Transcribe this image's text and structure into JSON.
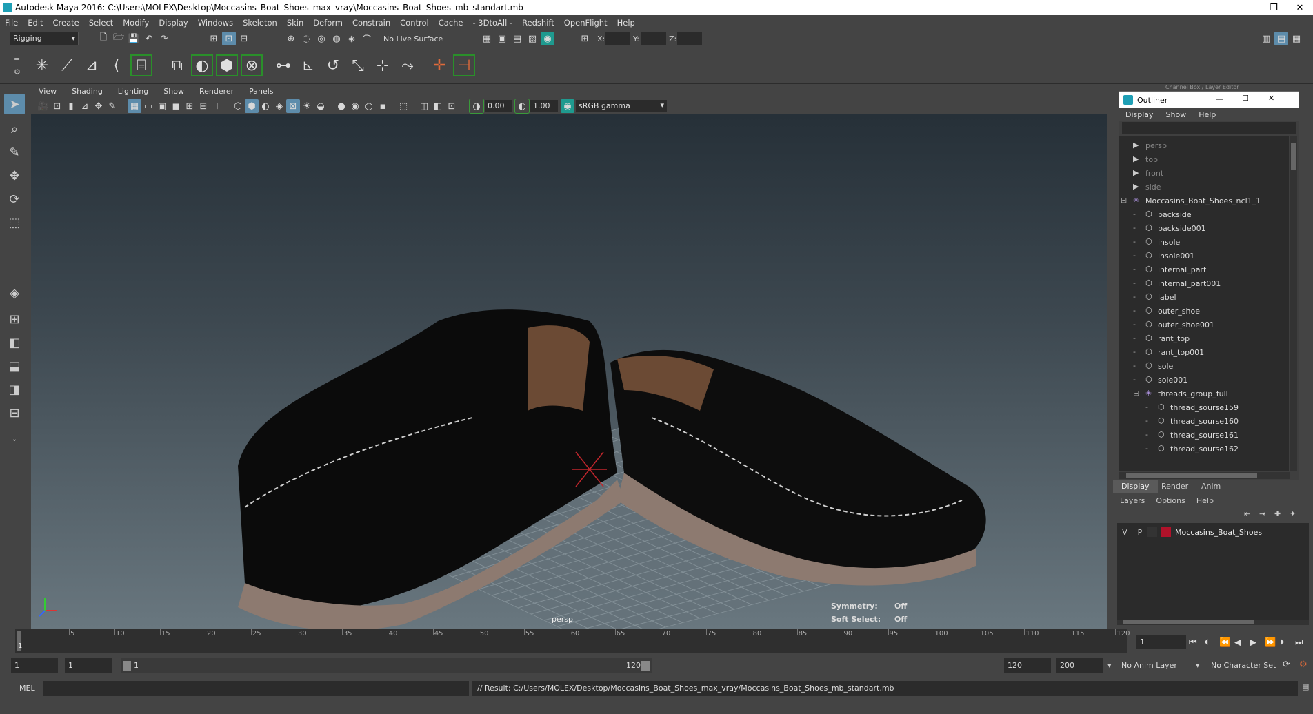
{
  "window": {
    "title": "Autodesk Maya 2016: C:\\Users\\MOLEX\\Desktop\\Moccasins_Boat_Shoes_max_vray\\Moccasins_Boat_Shoes_mb_standart.mb",
    "minimize": "—",
    "restore": "❐",
    "close": "✕"
  },
  "menus": [
    "File",
    "Edit",
    "Create",
    "Select",
    "Modify",
    "Display",
    "Windows",
    "Skeleton",
    "Skin",
    "Deform",
    "Constrain",
    "Control",
    "Cache",
    "- 3DtoAll -",
    "Redshift",
    "OpenFlight",
    "Help"
  ],
  "status_line": {
    "mode": "Rigging",
    "live_surface": "No Live Surface",
    "x_label": "X:",
    "y_label": "Y:",
    "z_label": "Z:"
  },
  "viewport": {
    "menus": [
      "View",
      "Shading",
      "Lighting",
      "Show",
      "Renderer",
      "Panels"
    ],
    "exposure": "0.00",
    "gamma": "1.00",
    "color_space": "sRGB gamma",
    "camera_label": "persp",
    "hud": {
      "symmetry_label": "Symmetry:",
      "symmetry_value": "Off",
      "soft_select_label": "Soft Select:",
      "soft_select_value": "Off"
    }
  },
  "channel_box_header": "Channel Box / Layer Editor",
  "outliner": {
    "title": "Outliner",
    "menus": [
      "Display",
      "Show",
      "Help"
    ],
    "items": [
      {
        "label": "persp",
        "kind": "camera",
        "depth": 0,
        "dim": true
      },
      {
        "label": "top",
        "kind": "camera",
        "depth": 0,
        "dim": true
      },
      {
        "label": "front",
        "kind": "camera",
        "depth": 0,
        "dim": true
      },
      {
        "label": "side",
        "kind": "camera",
        "depth": 0,
        "dim": true
      },
      {
        "label": "Moccasins_Boat_Shoes_ncl1_1",
        "kind": "group",
        "depth": 0,
        "expanded": true
      },
      {
        "label": "backside",
        "kind": "mesh",
        "depth": 1
      },
      {
        "label": "backside001",
        "kind": "mesh",
        "depth": 1
      },
      {
        "label": "insole",
        "kind": "mesh",
        "depth": 1
      },
      {
        "label": "insole001",
        "kind": "mesh",
        "depth": 1
      },
      {
        "label": "internal_part",
        "kind": "mesh",
        "depth": 1
      },
      {
        "label": "internal_part001",
        "kind": "mesh",
        "depth": 1
      },
      {
        "label": "label",
        "kind": "mesh",
        "depth": 1
      },
      {
        "label": "outer_shoe",
        "kind": "mesh",
        "depth": 1
      },
      {
        "label": "outer_shoe001",
        "kind": "mesh",
        "depth": 1
      },
      {
        "label": "rant_top",
        "kind": "mesh",
        "depth": 1
      },
      {
        "label": "rant_top001",
        "kind": "mesh",
        "depth": 1
      },
      {
        "label": "sole",
        "kind": "mesh",
        "depth": 1
      },
      {
        "label": "sole001",
        "kind": "mesh",
        "depth": 1
      },
      {
        "label": "threads_group_full",
        "kind": "group",
        "depth": 1,
        "expanded": true
      },
      {
        "label": "thread_sourse159",
        "kind": "mesh",
        "depth": 2
      },
      {
        "label": "thread_sourse160",
        "kind": "mesh",
        "depth": 2
      },
      {
        "label": "thread_sourse161",
        "kind": "mesh",
        "depth": 2
      },
      {
        "label": "thread_sourse162",
        "kind": "mesh",
        "depth": 2
      }
    ]
  },
  "layer_editor": {
    "tabs": [
      "Display",
      "Render",
      "Anim"
    ],
    "menus": [
      "Layers",
      "Options",
      "Help"
    ],
    "layer": {
      "visible": "V",
      "playback": "P",
      "name": "Moccasins_Boat_Shoes",
      "color": "#b0122a"
    }
  },
  "timeline": {
    "ticks": [
      "5",
      "10",
      "15",
      "20",
      "25",
      "30",
      "35",
      "40",
      "45",
      "50",
      "55",
      "60",
      "65",
      "70",
      "75",
      "80",
      "85",
      "90",
      "95",
      "100",
      "105",
      "110",
      "115",
      "120"
    ],
    "current_marker": "1",
    "current_frame": "1"
  },
  "range": {
    "start": "1",
    "playback_start": "1",
    "slider_start": "1",
    "slider_end": "120",
    "playback_end": "120",
    "end": "200",
    "anim_layer": "No Anim Layer",
    "character_set": "No Character Set"
  },
  "command": {
    "lang": "MEL",
    "result": "// Result: C:/Users/MOLEX/Desktop/Moccasins_Boat_Shoes_max_vray/Moccasins_Boat_Shoes_mb_standart.mb"
  }
}
